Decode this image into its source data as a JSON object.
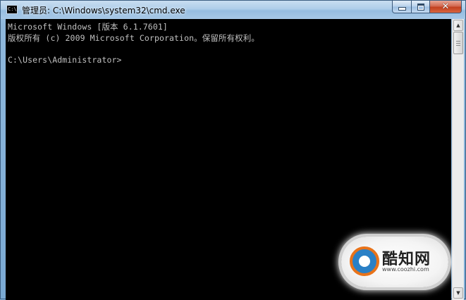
{
  "window": {
    "title": "管理员: C:\\Windows\\system32\\cmd.exe",
    "icon_label": "C:\\.",
    "controls": {
      "minimize": "minimize-icon",
      "maximize": "maximize-icon",
      "close": "✕"
    }
  },
  "console": {
    "lines": [
      "Microsoft Windows [版本 6.1.7601]",
      "版权所有 (c) 2009 Microsoft Corporation。保留所有权利。",
      "",
      "C:\\Users\\Administrator>"
    ]
  },
  "scrollbar": {
    "up_arrow": "▲",
    "down_arrow": "▼"
  },
  "watermark": {
    "title": "酷知网",
    "url": "www.coozhi.com"
  },
  "colors": {
    "console_bg": "#000000",
    "console_text": "#c0c0c0",
    "close_button": "#c2401f",
    "titlebar": "#aecde9"
  }
}
